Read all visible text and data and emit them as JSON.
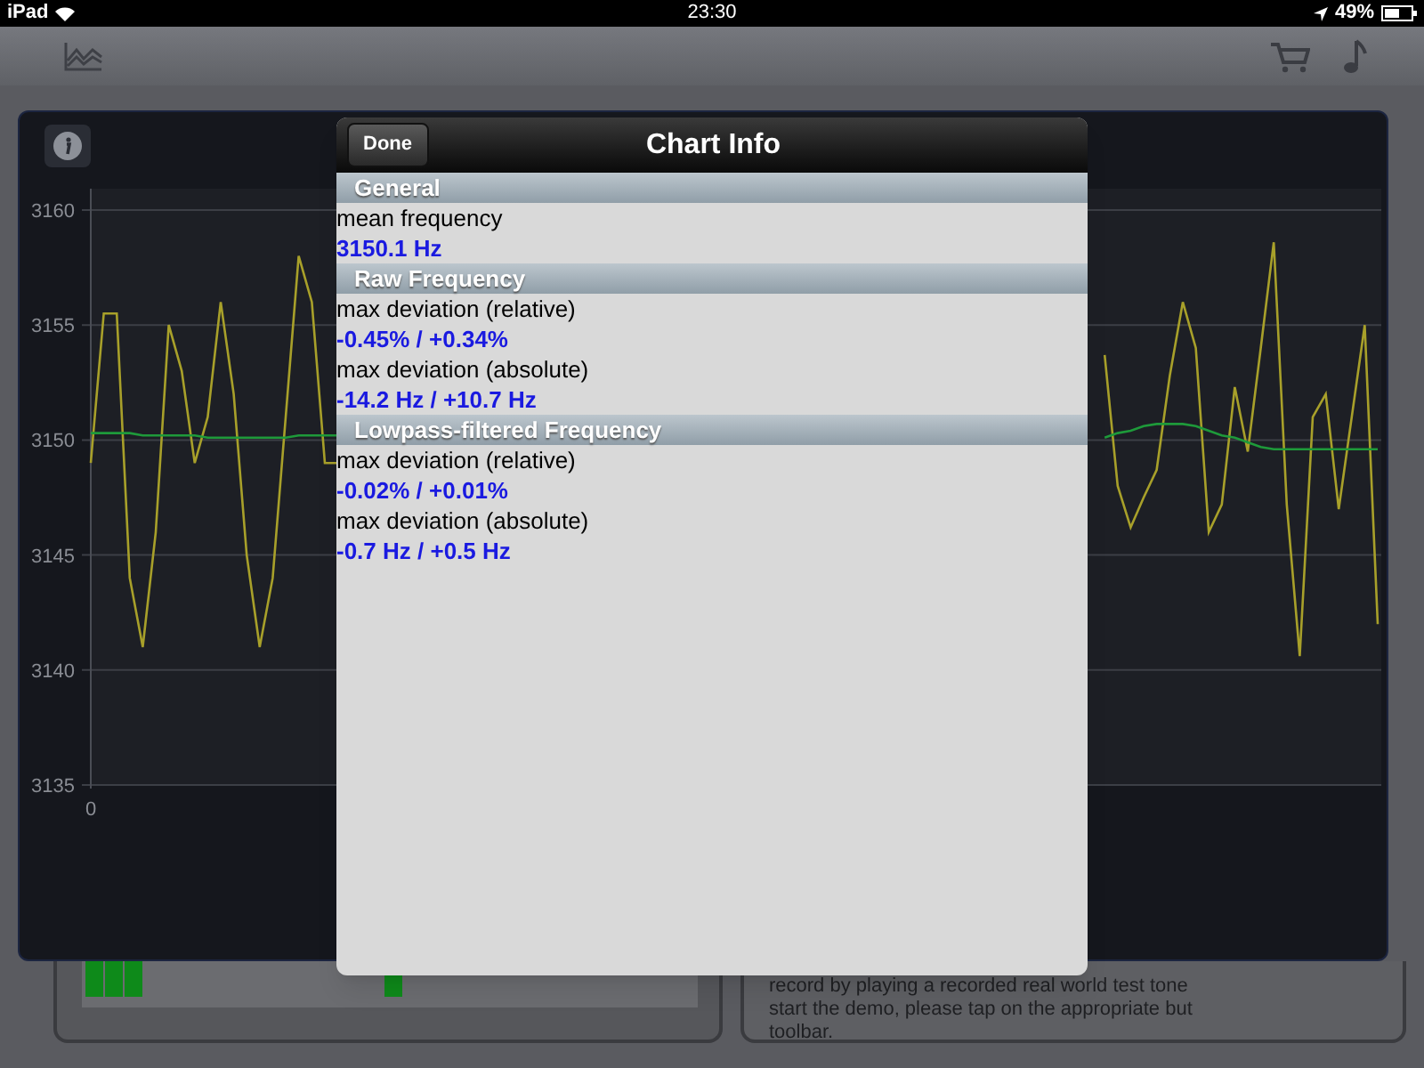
{
  "status_bar": {
    "device": "iPad",
    "time": "23:30",
    "battery": "49%"
  },
  "main_panel": {
    "chart_data": {
      "type": "line",
      "grid": true,
      "ylim": [
        3135,
        3160
      ],
      "yticks": [
        {
          "value": 3135,
          "label": "3135"
        },
        {
          "value": 3140,
          "label": "3140"
        },
        {
          "value": 3145,
          "label": "3145"
        },
        {
          "value": 3150,
          "label": "3150"
        },
        {
          "value": 3155,
          "label": "3155"
        },
        {
          "value": 3160,
          "label": "3160"
        }
      ],
      "annotations": [
        {
          "text": "0"
        }
      ],
      "series": [
        {
          "color": "#a8a02a",
          "values": [
            3149,
            3155.5,
            3155.5,
            3144,
            3141,
            3146,
            3155,
            3153,
            3149,
            3151,
            3156,
            3152,
            3145,
            3141,
            3144,
            3151,
            3158,
            3156,
            3149,
            3149,
            null,
            null,
            null,
            null,
            null,
            null,
            null,
            null,
            null,
            null,
            null,
            null,
            null,
            null,
            null,
            null,
            null,
            null,
            null,
            null,
            null,
            null,
            null,
            null,
            null,
            null,
            null,
            null,
            null,
            null,
            null,
            null,
            null,
            null,
            null,
            null,
            null,
            null,
            null,
            null,
            null,
            null,
            null,
            null,
            null,
            null,
            null,
            null,
            null,
            null,
            null,
            null,
            null,
            null,
            null,
            null,
            null,
            null,
            3153.7,
            3148,
            3146.2,
            3147.5,
            3148.7,
            3152.8,
            3156,
            3154,
            3146,
            3147.2,
            3152.3,
            3149.5,
            3154,
            3158.6,
            3147.2,
            3140.6,
            3151,
            3152,
            3147,
            3151,
            3155,
            3142
          ]
        },
        {
          "color": "#1e9a3a",
          "values": [
            3150.3,
            3150.3,
            3150.3,
            3150.3,
            3150.2,
            3150.2,
            3150.2,
            3150.2,
            3150.2,
            3150.1,
            3150.1,
            3150.1,
            3150.1,
            3150.1,
            3150.1,
            3150.1,
            3150.2,
            3150.2,
            3150.2,
            3150.2,
            null,
            null,
            null,
            null,
            null,
            null,
            null,
            null,
            null,
            null,
            null,
            null,
            null,
            null,
            null,
            null,
            null,
            null,
            null,
            null,
            null,
            null,
            null,
            null,
            null,
            null,
            null,
            null,
            null,
            null,
            null,
            null,
            null,
            null,
            null,
            null,
            null,
            null,
            null,
            null,
            null,
            null,
            null,
            null,
            null,
            null,
            null,
            null,
            null,
            null,
            null,
            null,
            null,
            null,
            null,
            null,
            null,
            null,
            3150.1,
            3150.3,
            3150.4,
            3150.6,
            3150.7,
            3150.7,
            3150.7,
            3150.6,
            3150.4,
            3150.2,
            3150.1,
            3149.9,
            3149.7,
            3149.6,
            3149.6,
            3149.6,
            3149.6,
            3149.6,
            3149.6,
            3149.6,
            3149.6,
            3149.6
          ]
        }
      ]
    }
  },
  "dialog": {
    "title": "Chart Info",
    "done_button": "Done",
    "sections": [
      {
        "title": "General",
        "items": [
          {
            "label": "mean frequency",
            "value": "3150.1 Hz"
          }
        ]
      },
      {
        "title": "Raw Frequency",
        "items": [
          {
            "label": "max deviation (relative)",
            "value": "-0.45% / +0.34%"
          },
          {
            "label": "max deviation (absolute)",
            "value": "-14.2 Hz / +10.7 Hz"
          }
        ]
      },
      {
        "title": "Lowpass-filtered Frequency",
        "items": [
          {
            "label": "max deviation (relative)",
            "value": "-0.02% / +0.01%"
          },
          {
            "label": "max deviation (absolute)",
            "value": "-0.7 Hz / +0.5 Hz"
          }
        ]
      }
    ]
  },
  "help_text": [
    "record by playing a recorded real world test tone",
    "start the demo, please tap on the appropriate but",
    "toolbar."
  ]
}
